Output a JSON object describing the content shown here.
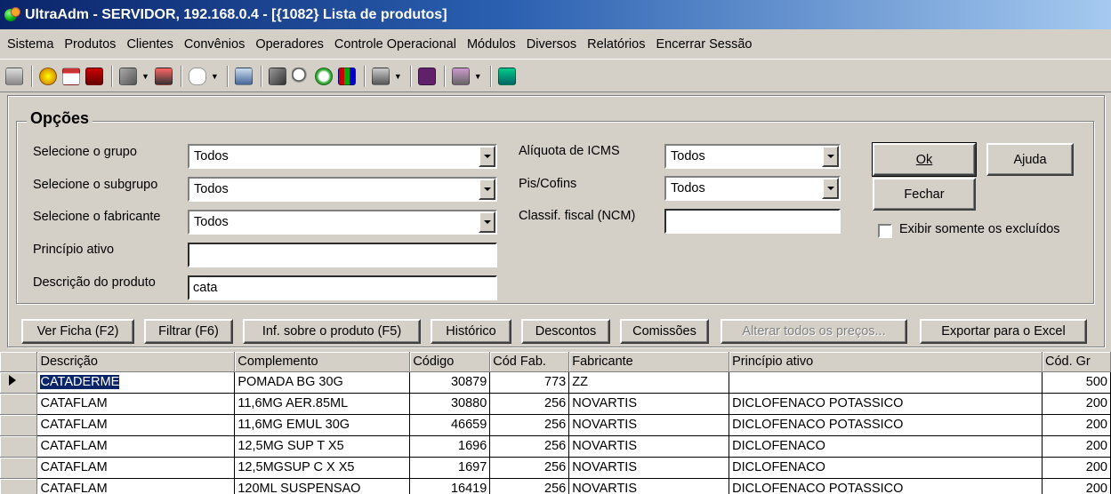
{
  "window": {
    "title": "UltraAdm - SERVIDOR, 192.168.0.4 - [{1082} Lista de produtos]"
  },
  "menu": [
    "Sistema",
    "Produtos",
    "Clientes",
    "Convênios",
    "Operadores",
    "Controle Operacional",
    "Módulos",
    "Diversos",
    "Relatórios",
    "Encerrar Sessão"
  ],
  "toolbar": {
    "icons": [
      "keyboard-icon",
      "help-globe-icon",
      "calendar-icon",
      "trash-icon",
      "link-icon",
      "truck-icon",
      "hand-icon",
      "printer-icon",
      "tools-icon",
      "magnifier-icon",
      "clock-icon",
      "bar-chart-icon",
      "camera-icon",
      "line-chart-icon",
      "table-icon",
      "exit-icon"
    ]
  },
  "options": {
    "title": "Opções",
    "grupo_label": "Selecione o grupo",
    "grupo_value": "Todos",
    "subgrupo_label": "Selecione o subgrupo",
    "subgrupo_value": "Todos",
    "fabricante_label": "Selecione o fabricante",
    "fabricante_value": "Todos",
    "principio_label": "Princípio ativo",
    "principio_value": "",
    "descricao_label": "Descrição do produto",
    "descricao_value": "cata",
    "icms_label": "Alíquota de ICMS",
    "icms_value": "Todos",
    "pis_label": "Pis/Cofins",
    "pis_value": "Todos",
    "ncm_label": "Classif. fiscal (NCM)",
    "ncm_value": "",
    "ok_label": "Ok",
    "ajuda_label": "Ajuda",
    "fechar_label": "Fechar",
    "excluidos_label": "Exibir somente os excluídos"
  },
  "actions": {
    "ver_ficha": "Ver Ficha (F2)",
    "filtrar": "Filtrar (F6)",
    "inf_produto": "Inf. sobre o produto (F5)",
    "historico": "Histórico",
    "descontos": "Descontos",
    "comissoes": "Comissões",
    "alterar_precos": "Alterar todos os preços...",
    "exportar": "Exportar para o Excel"
  },
  "grid": {
    "columns": [
      "Descrição",
      "Complemento",
      "Código",
      "Cód Fab.",
      "Fabricante",
      "Princípio ativo",
      "Cód. Gr"
    ],
    "rows": [
      [
        "CATADERME",
        "POMADA BG 30G",
        "30879",
        "773",
        "ZZ",
        "",
        "500"
      ],
      [
        "CATAFLAM",
        "11,6MG AER.85ML",
        "30880",
        "256",
        "NOVARTIS",
        "DICLOFENACO POTASSICO",
        "200"
      ],
      [
        "CATAFLAM",
        "11,6MG EMUL 30G",
        "46659",
        "256",
        "NOVARTIS",
        "DICLOFENACO POTASSICO",
        "200"
      ],
      [
        "CATAFLAM",
        "12,5MG SUP T X5",
        "1696",
        "256",
        "NOVARTIS",
        "DICLOFENACO",
        "200"
      ],
      [
        "CATAFLAM",
        "12,5MGSUP C X X5",
        "1697",
        "256",
        "NOVARTIS",
        "DICLOFENACO",
        "200"
      ],
      [
        "CATAFLAM",
        "120ML SUSPENSAO",
        "16419",
        "256",
        "NOVARTIS",
        "DICLOFENACO POTASSICO",
        "200"
      ]
    ]
  }
}
